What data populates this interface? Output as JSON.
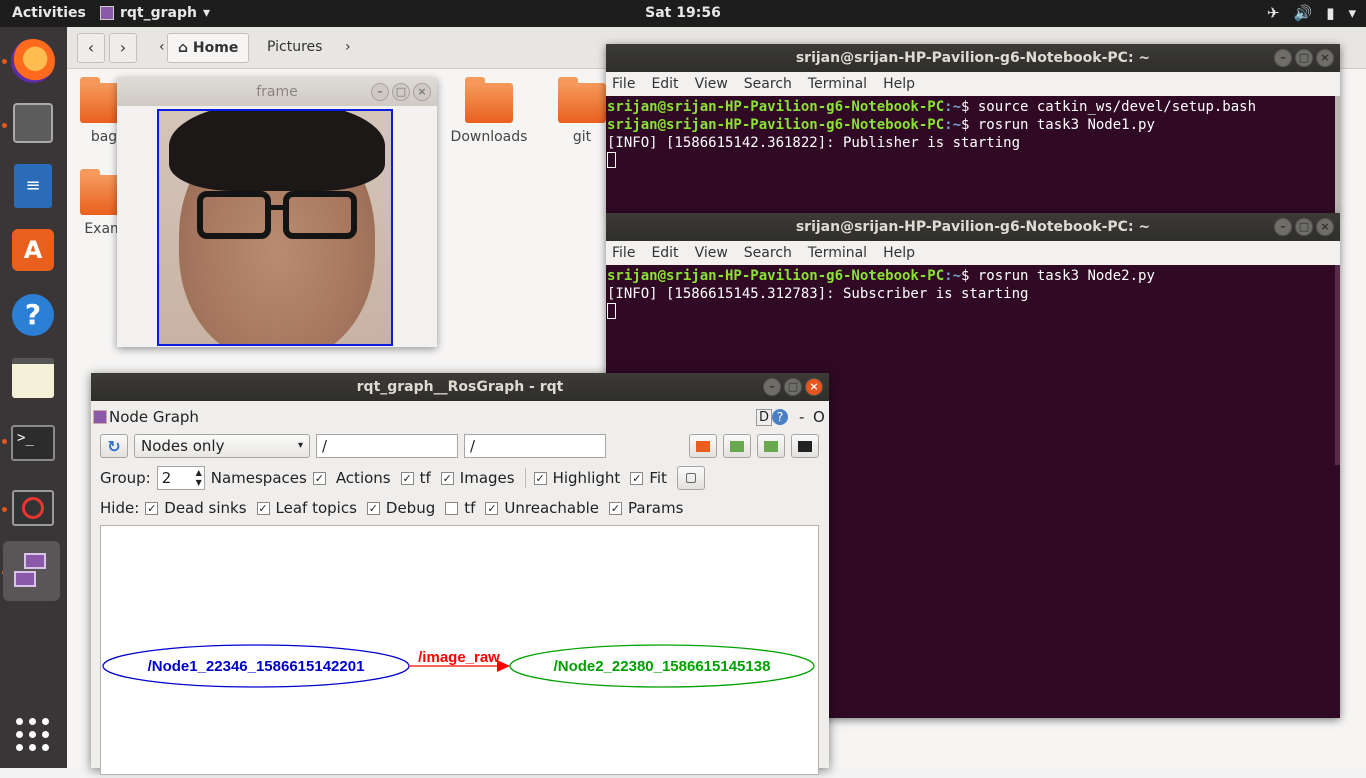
{
  "topbar": {
    "activities": "Activities",
    "app_name": "rqt_graph",
    "app_caret": "▾",
    "clock": "Sat 19:56",
    "tray_airplane": "✈",
    "tray_volume": "🔊",
    "tray_battery": "▮",
    "tray_menu": "▾"
  },
  "files": {
    "back": "‹",
    "forward": "›",
    "crumb_left": "‹",
    "home_icon": "⌂",
    "home": "Home",
    "pictures": "Pictures",
    "crumb_right": "›",
    "folders": {
      "bag": "bag",
      "exam": "Exam",
      "downloads": "Downloads",
      "git": "git"
    }
  },
  "frame": {
    "title": "frame"
  },
  "window_buttons": {
    "minimize": "–",
    "maximize": "□",
    "close": "×"
  },
  "terminal1": {
    "title": "srijan@srijan-HP-Pavilion-g6-Notebook-PC: ~",
    "menu": [
      "File",
      "Edit",
      "View",
      "Search",
      "Terminal",
      "Help"
    ],
    "user": "srijan@srijan-HP-Pavilion-g6-Notebook-PC",
    "path": ":~",
    "prompt": "$ ",
    "cmd1": "source catkin_ws/devel/setup.bash",
    "cmd2": "rosrun task3 Node1.py",
    "out1": "[INFO] [1586615142.361822]: Publisher is starting"
  },
  "terminal2": {
    "title": "srijan@srijan-HP-Pavilion-g6-Notebook-PC: ~",
    "menu": [
      "File",
      "Edit",
      "View",
      "Search",
      "Terminal",
      "Help"
    ],
    "user": "srijan@srijan-HP-Pavilion-g6-Notebook-PC",
    "path": ":~",
    "prompt": "$ ",
    "cmd1": "rosrun task3 Node2.py",
    "out1": "[INFO] [1586615145.312783]: Subscriber is starting"
  },
  "rqt": {
    "title": "rqt_graph__RosGraph - rqt",
    "plugin_name": "Node Graph",
    "plugin_ctrl_d": "D",
    "plugin_ctrl_help": "?",
    "plugin_ctrl_dash": "-",
    "plugin_ctrl_o": "O",
    "refresh_icon": "↻",
    "mode": "Nodes only",
    "combo_arrow": "▾",
    "filter1": "/",
    "filter2": "/",
    "group_label": "Group:",
    "group_value": "2",
    "spin_up": "▲",
    "spin_down": "▼",
    "check_mark": "✓",
    "options": {
      "namespaces": "Namespaces",
      "actions": "Actions",
      "tf": "tf",
      "images": "Images",
      "highlight": "Highlight",
      "fit": "Fit"
    },
    "hide_label": "Hide:",
    "hide": {
      "dead_sinks": "Dead sinks",
      "leaf_topics": "Leaf topics",
      "debug": "Debug",
      "tf": "tf",
      "unreachable": "Unreachable",
      "params": "Params"
    },
    "graph": {
      "node1": "/Node1_22346_1586615142201",
      "node2": "/Node2_22380_1586615145138",
      "topic": "/image_raw",
      "node1_color": "#0000cc",
      "node2_color": "#00a000",
      "edge_color": "#ff0000"
    }
  }
}
